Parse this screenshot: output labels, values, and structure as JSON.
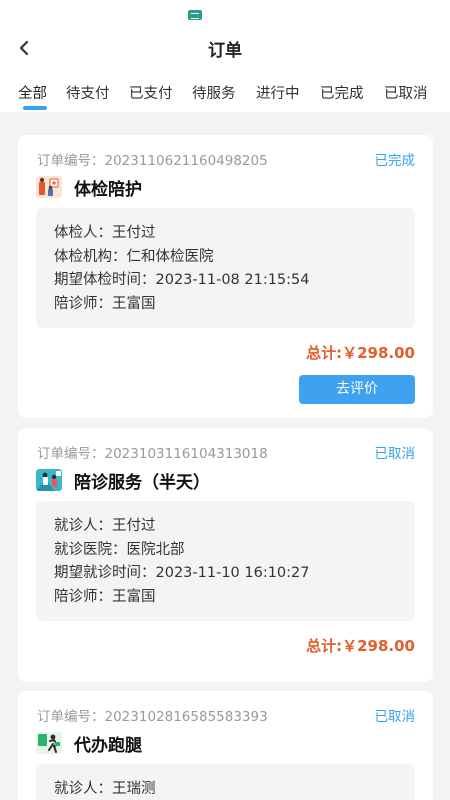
{
  "header": {
    "title": "订单",
    "back_icon": "chevron-left-icon"
  },
  "tabs": [
    {
      "label": "全部",
      "active": true
    },
    {
      "label": "待支付"
    },
    {
      "label": "已支付"
    },
    {
      "label": "待服务"
    },
    {
      "label": "进行中"
    },
    {
      "label": "已完成"
    },
    {
      "label": "已取消"
    }
  ],
  "colors": {
    "accent": "#3aa0ee",
    "price": "#e55d2b",
    "background": "#f2f3f5"
  },
  "orders": [
    {
      "order_no": "订单编号：2023110621160498205",
      "status": "已完成",
      "service": "体检陪护",
      "icon": "checkup-escort-icon",
      "lines": [
        "体检人：王付过",
        "体检机构：仁和体检医院",
        "期望体检时间：2023-11-08 21:15:54",
        "陪诊师：王富国"
      ],
      "total": "总计:￥298.00",
      "action": "去评价"
    },
    {
      "order_no": "订单编号：2023103116104313018",
      "status": "已取消",
      "service": "陪诊服务（半天）",
      "icon": "escort-service-icon",
      "lines": [
        "就诊人：王付过",
        "就诊医院：医院北部",
        "期望就诊时间：2023-11-10 16:10:27",
        "陪诊师：王富国"
      ],
      "total": "总计:￥298.00"
    },
    {
      "order_no": "订单编号：2023102816585583393",
      "status": "已取消",
      "service": "代办跑腿",
      "icon": "errand-runner-icon",
      "lines": [
        "就诊人：王瑞测"
      ]
    }
  ]
}
